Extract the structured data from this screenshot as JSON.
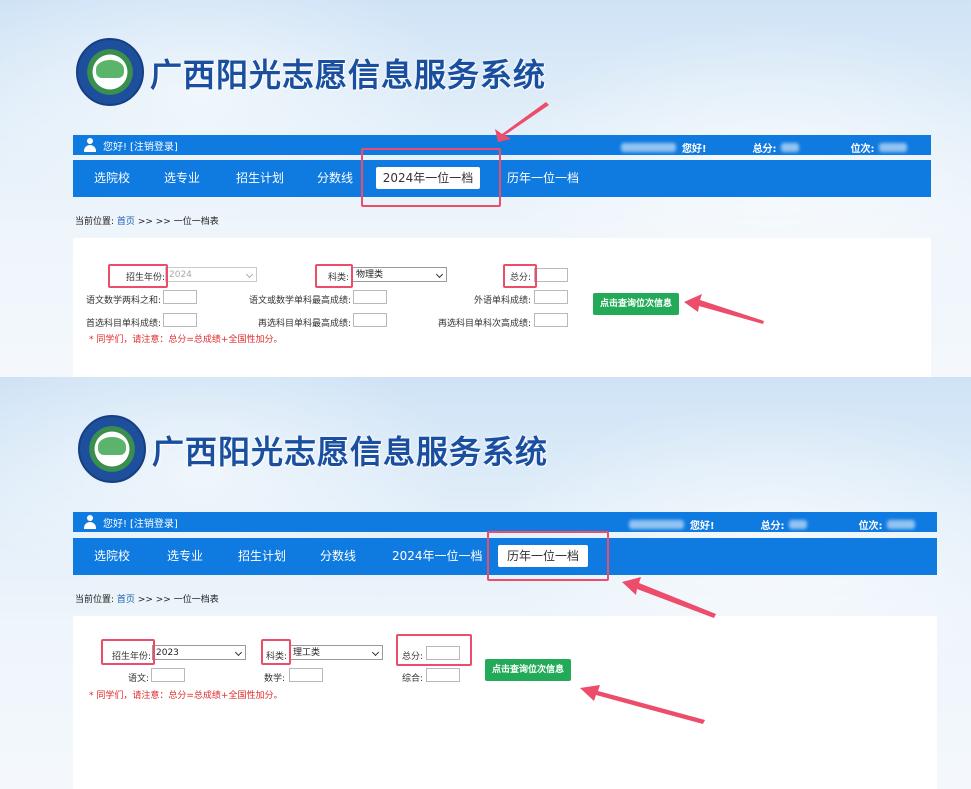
{
  "colors": {
    "primary_blue": "#0f7ae0",
    "title_blue": "#1a4fa0",
    "query_green": "#22aa58",
    "notice_red": "#e02b2b",
    "highlight_pink": "#ec4d6b"
  },
  "header": {
    "site_title": "广西阳光志愿信息服务系统",
    "logo_icon": "logo-emblem-icon"
  },
  "userbar": {
    "greeting": "您好!",
    "logout_link": "[注销登录]",
    "hello_label": "您好!",
    "score_label": "总分:",
    "rank_label": "位次:"
  },
  "nav": {
    "items": [
      "选院校",
      "选专业",
      "招生计划",
      "分数线",
      "2024年一位一档",
      "历年一位一档"
    ]
  },
  "breadcrumb": {
    "prefix": "当前位置:",
    "home": "首页",
    "path": ">> >> 一位一档表"
  },
  "top_form": {
    "year_label": "招生年份:",
    "year_value": "2024",
    "subject_label": "科类:",
    "subject_value": "物理类",
    "total_label": "总分:",
    "row2": [
      "语文数学两科之和:",
      "语文或数学单科最高成绩:",
      "外语单科成绩:"
    ],
    "row3": [
      "首选科目单科成绩:",
      "再选科目单科最高成绩:",
      "再选科目单科次高成绩:"
    ],
    "query_button": "点击查询位次信息",
    "notice": "* 同学们，请注意：总分=总成绩+全国性加分。"
  },
  "bottom_form": {
    "year_label": "招生年份:",
    "year_value": "2023",
    "subject_label": "科类:",
    "subject_value": "理工类",
    "total_label": "总分:",
    "chinese_label": "语文:",
    "math_label": "数学:",
    "composite_label": "综合:",
    "query_button": "点击查询位次信息",
    "notice": "* 同学们，请注意：总分=总成绩+全国性加分。"
  }
}
